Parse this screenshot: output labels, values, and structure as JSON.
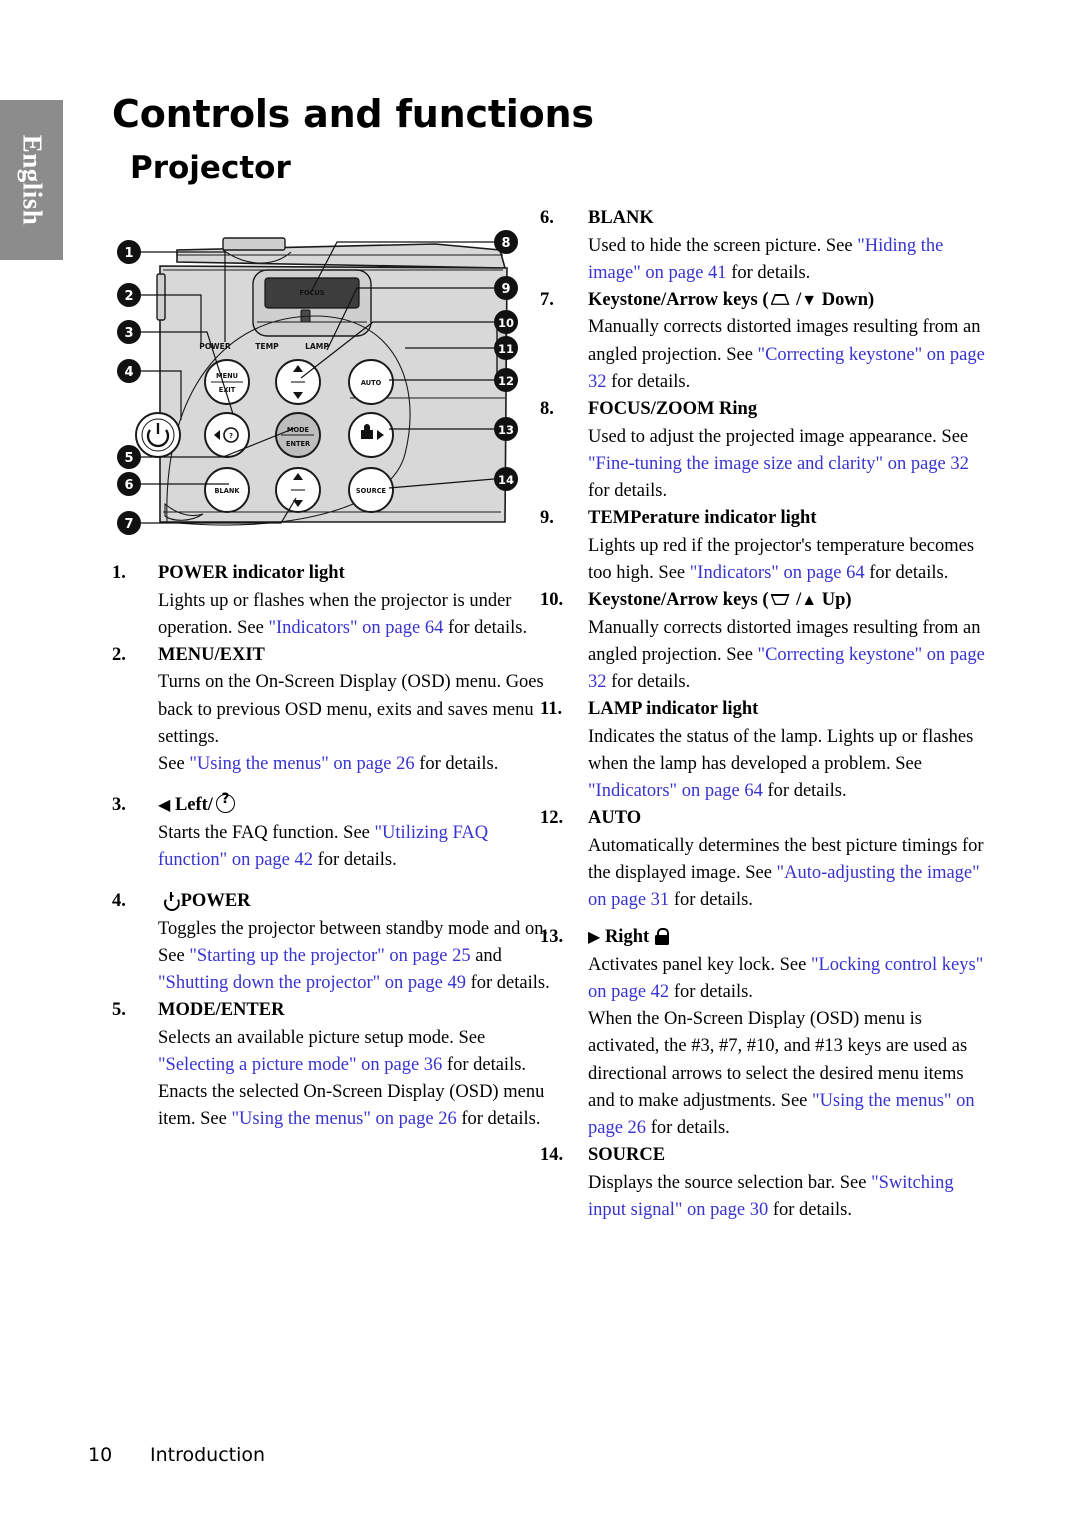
{
  "language_tab": {
    "label": "English"
  },
  "header": {
    "title": "Controls and functions",
    "subtitle": "Projector"
  },
  "footer": {
    "page_number": "10",
    "section": "Introduction"
  },
  "diagram": {
    "name": "projector-top-control-panel",
    "callouts_left": [
      "1",
      "2",
      "3",
      "4",
      "5",
      "6",
      "7"
    ],
    "callouts_right": [
      "8",
      "9",
      "10",
      "11",
      "12",
      "13",
      "14"
    ],
    "indicator_labels": [
      "POWER",
      "TEMP",
      "LAMP"
    ],
    "lens_label": "FOCUS",
    "buttons": [
      {
        "id": "menu-exit",
        "line1": "MENU",
        "line2": "EXIT"
      },
      {
        "id": "power",
        "line1": "",
        "line2": ""
      },
      {
        "id": "left-faq",
        "line1": "",
        "line2": ""
      },
      {
        "id": "mode-enter",
        "line1": "MODE",
        "line2": "ENTER"
      },
      {
        "id": "blank",
        "line1": "BLANK",
        "line2": ""
      },
      {
        "id": "auto",
        "line1": "AUTO",
        "line2": ""
      },
      {
        "id": "right-lock",
        "line1": "",
        "line2": ""
      },
      {
        "id": "source",
        "line1": "SOURCE",
        "line2": ""
      },
      {
        "id": "keystone-up",
        "line1": "",
        "line2": ""
      },
      {
        "id": "keystone-down",
        "line1": "",
        "line2": ""
      }
    ]
  },
  "left_column": {
    "items": [
      {
        "num": "1.",
        "term": "POWER indicator light",
        "paragraphs": [
          [
            {
              "t": "Lights up or flashes when the projector is under operation. See ",
              "link": false
            },
            {
              "t": "\"Indicators\" on page 64",
              "link": true
            },
            {
              "t": " for details.",
              "link": false
            }
          ]
        ]
      },
      {
        "num": "2.",
        "term": "MENU/EXIT",
        "paragraphs": [
          [
            {
              "t": "Turns on the On-Screen Display (OSD) menu. Goes back to previous OSD menu, exits and saves menu settings.",
              "link": false
            }
          ],
          [
            {
              "t": "See ",
              "link": false
            },
            {
              "t": "\"Using the menus\" on page 26",
              "link": true
            },
            {
              "t": " for details.",
              "link": false
            }
          ]
        ]
      },
      {
        "num": "3.",
        "term": "Left/",
        "term_prefix_icon": "left-triangle-icon",
        "term_suffix_icon": "question-circle-icon",
        "paragraphs": [
          [
            {
              "t": "Starts the FAQ function. See ",
              "link": false
            },
            {
              "t": "\"Utilizing FAQ function\" on page 42",
              "link": true
            },
            {
              "t": " for details.",
              "link": false
            }
          ]
        ]
      },
      {
        "num": "4.",
        "term": "POWER",
        "term_prefix_icon": "power-symbol-icon",
        "paragraphs": [
          [
            {
              "t": "Toggles the projector between standby mode and on.",
              "link": false
            }
          ],
          [
            {
              "t": "See ",
              "link": false
            },
            {
              "t": "\"Starting up the projector\" on page 25",
              "link": true
            },
            {
              "t": " and ",
              "link": false
            },
            {
              "t": "\"Shutting down the projector\" on page 49",
              "link": true
            },
            {
              "t": " for details.",
              "link": false
            }
          ]
        ]
      },
      {
        "num": "5.",
        "term": "MODE/ENTER",
        "paragraphs": [
          [
            {
              "t": "Selects an available picture setup mode. See ",
              "link": false
            },
            {
              "t": "\"Selecting a picture mode\" on page 36",
              "link": true
            },
            {
              "t": " for details.",
              "link": false
            }
          ],
          [
            {
              "t": "Enacts the selected On-Screen Display (OSD) menu item. See ",
              "link": false
            },
            {
              "t": "\"Using the menus\" on page 26",
              "link": true
            },
            {
              "t": " for details.",
              "link": false
            }
          ]
        ]
      }
    ]
  },
  "right_column": {
    "items": [
      {
        "num": "6.",
        "term": "BLANK",
        "paragraphs": [
          [
            {
              "t": "Used to hide the screen picture. See ",
              "link": false
            },
            {
              "t": "\"Hiding the image\" on page 41",
              "link": true
            },
            {
              "t": " for details.",
              "link": false
            }
          ]
        ]
      },
      {
        "num": "7.",
        "term_parts": [
          "Keystone/Arrow keys (",
          " /",
          " Down)"
        ],
        "term_icons": [
          "keystone-trapezoid-up-icon",
          "down-triangle-icon"
        ],
        "paragraphs": [
          [
            {
              "t": "Manually corrects distorted images resulting from an angled projection. See ",
              "link": false
            },
            {
              "t": "\"Correcting keystone\" on page 32",
              "link": true
            },
            {
              "t": " for details.",
              "link": false
            }
          ]
        ]
      },
      {
        "num": "8.",
        "term": "FOCUS/ZOOM Ring",
        "paragraphs": [
          [
            {
              "t": "Used to adjust the projected image appearance. See ",
              "link": false
            },
            {
              "t": "\"Fine-tuning the image size and clarity\" on page 32",
              "link": true
            },
            {
              "t": " for details.",
              "link": false
            }
          ]
        ]
      },
      {
        "num": "9.",
        "term": "TEMPerature indicator light",
        "paragraphs": [
          [
            {
              "t": "Lights up red if the projector's temperature becomes too high. See ",
              "link": false
            },
            {
              "t": "\"Indicators\" on page 64",
              "link": true
            },
            {
              "t": " for details.",
              "link": false
            }
          ]
        ]
      },
      {
        "num": "10.",
        "term_parts": [
          "Keystone/Arrow keys (",
          " /",
          " Up)"
        ],
        "term_icons": [
          "keystone-trapezoid-down-icon",
          "up-triangle-icon"
        ],
        "paragraphs": [
          [
            {
              "t": "Manually corrects distorted images resulting from an angled projection. See ",
              "link": false
            },
            {
              "t": "\"Correcting keystone\" on page 32",
              "link": true
            },
            {
              "t": " for details.",
              "link": false
            }
          ]
        ]
      },
      {
        "num": "11.",
        "term": "LAMP indicator light",
        "paragraphs": [
          [
            {
              "t": "Indicates the status of the lamp. Lights up or flashes when the lamp has developed a problem. See ",
              "link": false
            },
            {
              "t": "\"Indicators\" on page 64",
              "link": true
            },
            {
              "t": " for details.",
              "link": false
            }
          ]
        ]
      },
      {
        "num": "12.",
        "term": "AUTO",
        "paragraphs": [
          [
            {
              "t": "Automatically determines the best picture timings for the displayed image. See ",
              "link": false
            },
            {
              "t": "\"Auto-adjusting the image\" on page 31",
              "link": true
            },
            {
              "t": " for details.",
              "link": false
            }
          ]
        ]
      },
      {
        "num": "13.",
        "term": "Right",
        "term_prefix_icon": "right-triangle-icon",
        "term_suffix_icon": "lock-icon",
        "paragraphs": [
          [
            {
              "t": "Activates panel key lock. See ",
              "link": false
            },
            {
              "t": "\"Locking control keys\" on page 42",
              "link": true
            },
            {
              "t": " for details.",
              "link": false
            }
          ],
          [
            {
              "t": "When the On-Screen Display (OSD) menu is activated, the #3,  #7, #10, and #13 keys are used as directional arrows to select the desired menu items and to make adjustments. See ",
              "link": false
            },
            {
              "t": "\"Using the menus\" on page 26",
              "link": true
            },
            {
              "t": " for details.",
              "link": false
            }
          ]
        ]
      },
      {
        "num": "14.",
        "term": "SOURCE",
        "paragraphs": [
          [
            {
              "t": "Displays the source selection bar. See ",
              "link": false
            },
            {
              "t": "\"Switching input signal\" on page 30",
              "link": true
            },
            {
              "t": " for details.",
              "link": false
            }
          ]
        ]
      }
    ]
  },
  "colors": {
    "link": "#3833d0",
    "tab_background": "#8c8c8c",
    "text": "#000000"
  }
}
